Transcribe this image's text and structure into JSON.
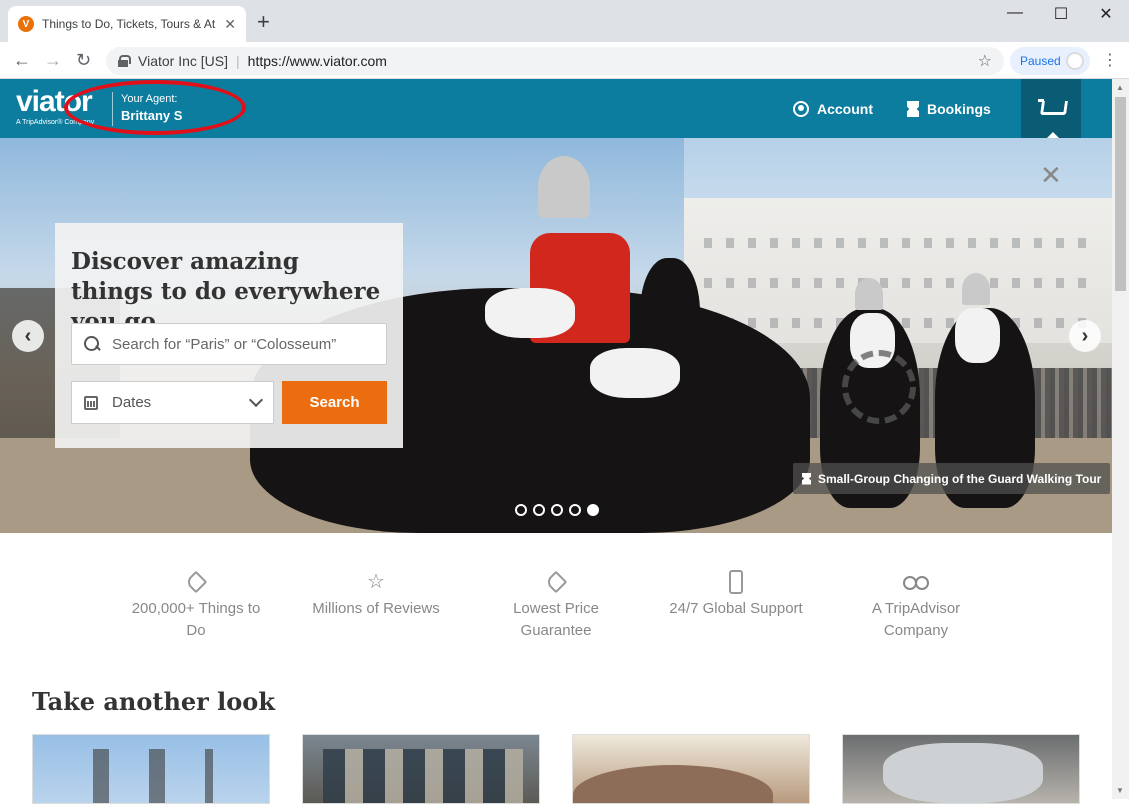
{
  "browser": {
    "tab_title": "Things to Do, Tickets, Tours & At",
    "tab_favicon": "V",
    "new_tab": "+",
    "site_identity": "Viator Inc [US]",
    "url": "https://www.viator.com",
    "profile_status": "Paused",
    "window_controls": {
      "minimize": "—",
      "maximize": "☐",
      "close": "✕"
    }
  },
  "header": {
    "logo_text": "viator",
    "logo_sub": "A TripAdvisor® Company",
    "agent_label": "Your Agent:",
    "agent_name": "Brittany S",
    "account_label": "Account",
    "bookings_label": "Bookings",
    "accent_color": "#0d7d9f"
  },
  "hero": {
    "headline": "Discover amazing things to do everywhere you go",
    "search_placeholder": "Search for “Paris” or “Colosseum”",
    "dates_label": "Dates",
    "search_button": "Search",
    "caption": "Small-Group Changing of the Guard Walking Tour",
    "dot_count": 5,
    "active_dot": 5,
    "button_color": "#ec6d0f"
  },
  "features": [
    {
      "icon": "tag-icon",
      "label": "200,000+ Things to Do"
    },
    {
      "icon": "star-icon",
      "label": "Millions of Reviews"
    },
    {
      "icon": "price-tag-icon",
      "label": "Lowest Price Guarantee"
    },
    {
      "icon": "phone-icon",
      "label": "24/7 Global Support"
    },
    {
      "icon": "owl-icon",
      "label": "A TripAdvisor Company"
    }
  ],
  "section": {
    "title": "Take another look"
  }
}
